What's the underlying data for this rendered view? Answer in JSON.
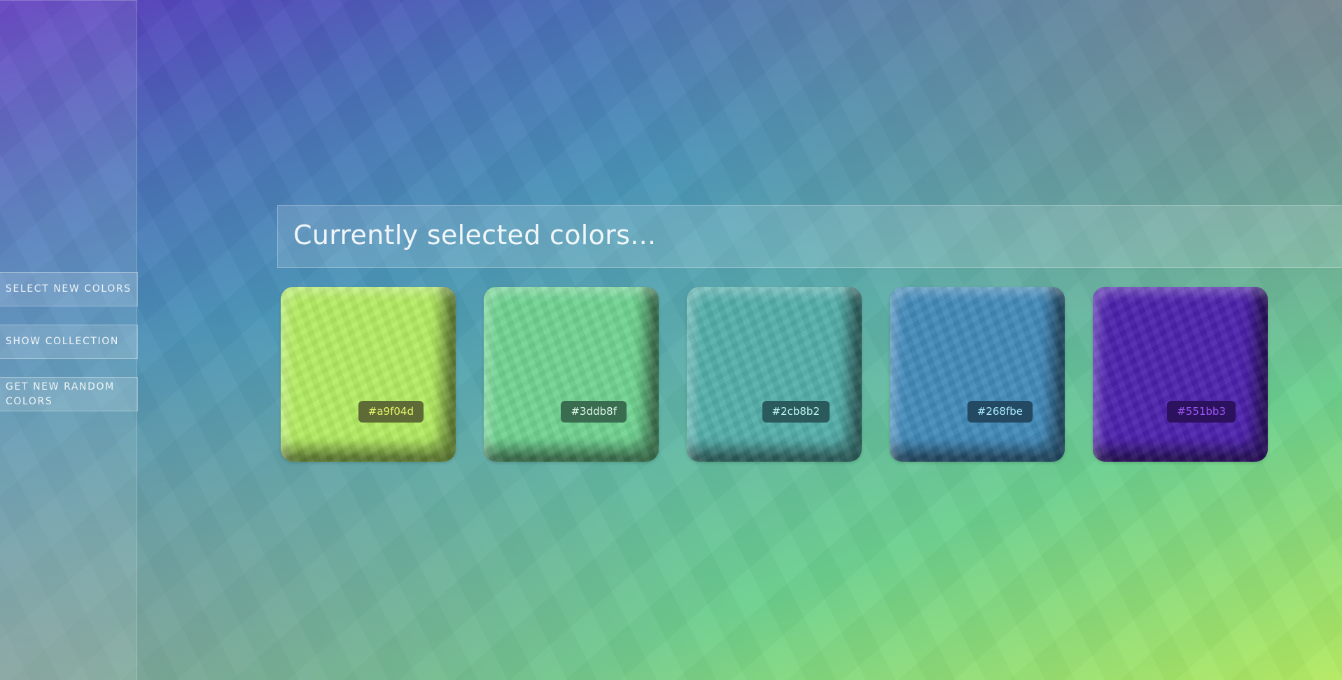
{
  "sidebar": {
    "buttons": [
      {
        "label": "SELECT NEW COLORS"
      },
      {
        "label": "SHOW COLLECTION"
      },
      {
        "label": "GET NEW RANDOM COLORS"
      }
    ]
  },
  "header": {
    "title": "Currently selected colors..."
  },
  "swatches": [
    {
      "hex": "#a9f04d",
      "fill": "#b4ec62",
      "label_bg": "#5f6b36",
      "label_color": "#e6f56a"
    },
    {
      "hex": "#3ddb8f",
      "fill": "#70d492",
      "label_bg": "#3a6d4f",
      "label_color": "#dff5e8"
    },
    {
      "hex": "#2cb8b2",
      "fill": "#55b0ac",
      "label_bg": "#2a5a5c",
      "label_color": "#bff3f1"
    },
    {
      "hex": "#268fbe",
      "fill": "#438bbb",
      "label_bg": "#234a62",
      "label_color": "#a9e8ff"
    },
    {
      "hex": "#551bb3",
      "fill": "#4d22ae",
      "label_bg": "#2b115e",
      "label_color": "#9c55f2"
    }
  ]
}
